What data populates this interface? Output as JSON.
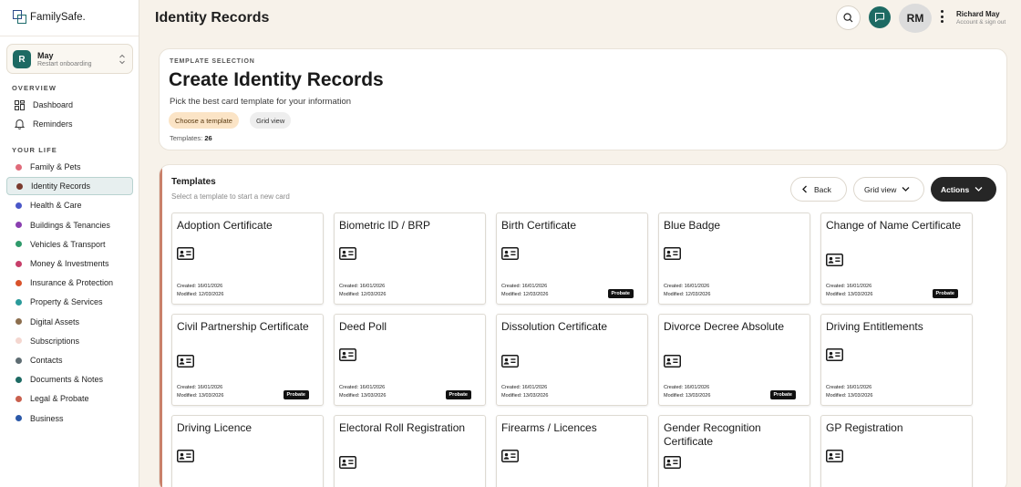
{
  "brand": {
    "name": "FamilySafe."
  },
  "account": {
    "initial": "R",
    "name": "May",
    "subtitle": "Restart onboarding"
  },
  "sidebar": {
    "overview_label": "OVERVIEW",
    "overview_items": [
      {
        "label": "Dashboard",
        "icon": "dashboard-icon"
      },
      {
        "label": "Reminders",
        "icon": "bell-icon"
      }
    ],
    "your_life_label": "YOUR LIFE",
    "life_items": [
      {
        "label": "Family & Pets",
        "color": "#e06b7a"
      },
      {
        "label": "Identity Records",
        "color": "#7a3b2e",
        "active": true
      },
      {
        "label": "Health & Care",
        "color": "#4a57c8"
      },
      {
        "label": "Buildings & Tenancies",
        "color": "#8a3fb0"
      },
      {
        "label": "Vehicles & Transport",
        "color": "#2f9a6b"
      },
      {
        "label": "Money & Investments",
        "color": "#c73f6a"
      },
      {
        "label": "Insurance & Protection",
        "color": "#d9532b"
      },
      {
        "label": "Property & Services",
        "color": "#2a9a9a"
      },
      {
        "label": "Digital Assets",
        "color": "#8c6e4e"
      },
      {
        "label": "Subscriptions",
        "color": "#f4d6cf"
      },
      {
        "label": "Contacts",
        "color": "#5e6c72"
      },
      {
        "label": "Documents & Notes",
        "color": "#1d6a63"
      },
      {
        "label": "Legal & Probate",
        "color": "#c9604e"
      },
      {
        "label": "Business",
        "color": "#2b58a8"
      }
    ]
  },
  "header": {
    "title": "Identity Records",
    "user_initials": "RM",
    "user_name": "Richard May",
    "user_sub": "Account & sign out"
  },
  "intro": {
    "eyebrow": "TEMPLATE SELECTION",
    "title": "Create Identity Records",
    "subtitle": "Pick the best card template for your information",
    "chip_primary": "Choose a template",
    "chip_secondary": "Grid view",
    "count_label": "Templates:",
    "count_value": "26"
  },
  "panel": {
    "title": "Templates",
    "subtitle": "Select a template to start a new card",
    "back_label": "Back",
    "view_label": "Grid view",
    "actions_label": "Actions"
  },
  "templates": [
    {
      "name": "Adoption Certificate",
      "created": "Created: 16/01/2026",
      "modified": "Modified: 12/03/2026",
      "badge": ""
    },
    {
      "name": "Biometric ID / BRP",
      "created": "Created: 16/01/2026",
      "modified": "Modified: 12/03/2026",
      "badge": ""
    },
    {
      "name": "Birth Certificate",
      "created": "Created: 16/01/2026",
      "modified": "Modified: 12/03/2026",
      "badge": "Probate"
    },
    {
      "name": "Blue Badge",
      "created": "Created: 16/01/2026",
      "modified": "Modified: 12/03/2026",
      "badge": ""
    },
    {
      "name": "Change of Name Certificate",
      "created": "Created: 16/01/2026",
      "modified": "Modified: 13/03/2026",
      "badge": "Probate"
    },
    {
      "name": "Civil Partnership Certificate",
      "created": "Created: 16/01/2026",
      "modified": "Modified: 13/03/2026",
      "badge": "Probate"
    },
    {
      "name": "Deed Poll",
      "created": "Created: 16/01/2026",
      "modified": "Modified: 13/03/2026",
      "badge": "Probate"
    },
    {
      "name": "Dissolution Certificate",
      "created": "Created: 16/01/2026",
      "modified": "Modified: 13/03/2026",
      "badge": ""
    },
    {
      "name": "Divorce Decree Absolute",
      "created": "Created: 16/01/2026",
      "modified": "Modified: 13/03/2026",
      "badge": "Probate"
    },
    {
      "name": "Driving Entitlements",
      "created": "Created: 16/01/2026",
      "modified": "Modified: 13/03/2026",
      "badge": ""
    },
    {
      "name": "Driving Licence",
      "created": "",
      "modified": "",
      "badge": ""
    },
    {
      "name": "Electoral Roll Registration",
      "created": "",
      "modified": "",
      "badge": ""
    },
    {
      "name": "Firearms / Licences",
      "created": "",
      "modified": "",
      "badge": ""
    },
    {
      "name": "Gender Recognition Certificate",
      "created": "",
      "modified": "",
      "badge": ""
    },
    {
      "name": "GP Registration",
      "created": "",
      "modified": "",
      "badge": ""
    }
  ]
}
